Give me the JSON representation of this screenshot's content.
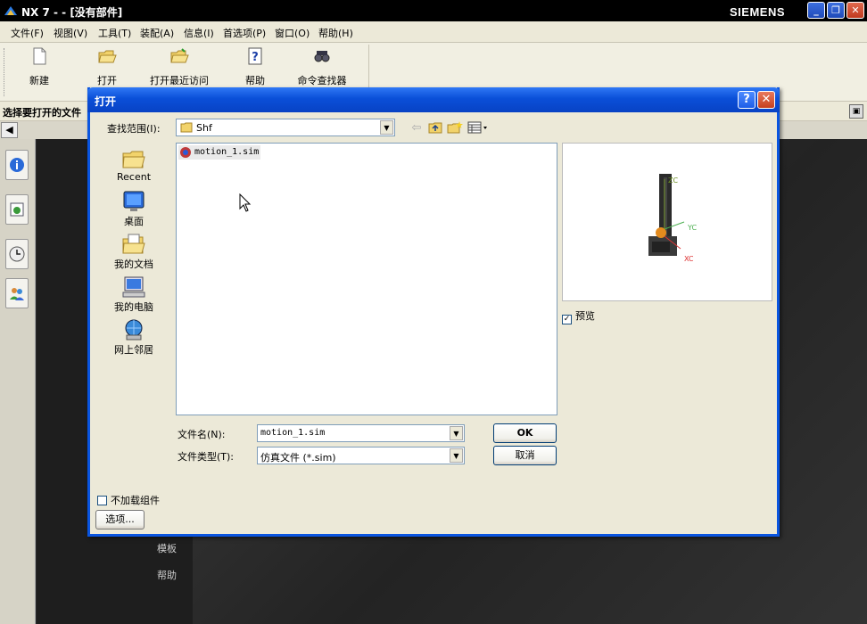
{
  "window": {
    "title": "NX 7 -  - [没有部件]",
    "brand": "SIEMENS",
    "controls": {
      "minimize": "_",
      "restore": "❐",
      "close": "✕"
    }
  },
  "menu": [
    "文件(F)",
    "视图(V)",
    "工具(T)",
    "装配(A)",
    "信息(I)",
    "首选项(P)",
    "窗口(O)",
    "帮助(H)"
  ],
  "toolbar": {
    "buttons": [
      {
        "label": "新建",
        "icon": "new-document-icon"
      },
      {
        "label": "打开",
        "icon": "open-folder-icon"
      },
      {
        "label": "打开最近访问",
        "icon": "open-recent-icon"
      },
      {
        "label": "帮助",
        "icon": "help-icon"
      },
      {
        "label": "命令查找器",
        "icon": "binoculars-icon"
      }
    ]
  },
  "cue": "选择要打开的文件",
  "graphics_labels": [
    "模板",
    "帮助"
  ],
  "dialog": {
    "title": "打开",
    "help": "?",
    "close": "✕",
    "look_in_label": "查找范围(I):",
    "look_in_value": "Shf",
    "places": [
      "Recent",
      "桌面",
      "我的文档",
      "我的电脑",
      "网上邻居"
    ],
    "files": [
      {
        "name": "motion_1.sim",
        "icon": "sim-file-icon"
      }
    ],
    "preview_checkbox": {
      "label": "预览",
      "checked": true
    },
    "preview_axes": {
      "x": "XC",
      "y": "YC",
      "z": "ZC"
    },
    "file_name_label": "文件名(N):",
    "file_name_value": "motion_1.sim",
    "file_type_label": "文件类型(T):",
    "file_type_value": "仿真文件 (*.sim)",
    "ok": "OK",
    "cancel": "取消",
    "no_load_label": "不加载组件",
    "no_load_checked": false,
    "options": "选项..."
  }
}
